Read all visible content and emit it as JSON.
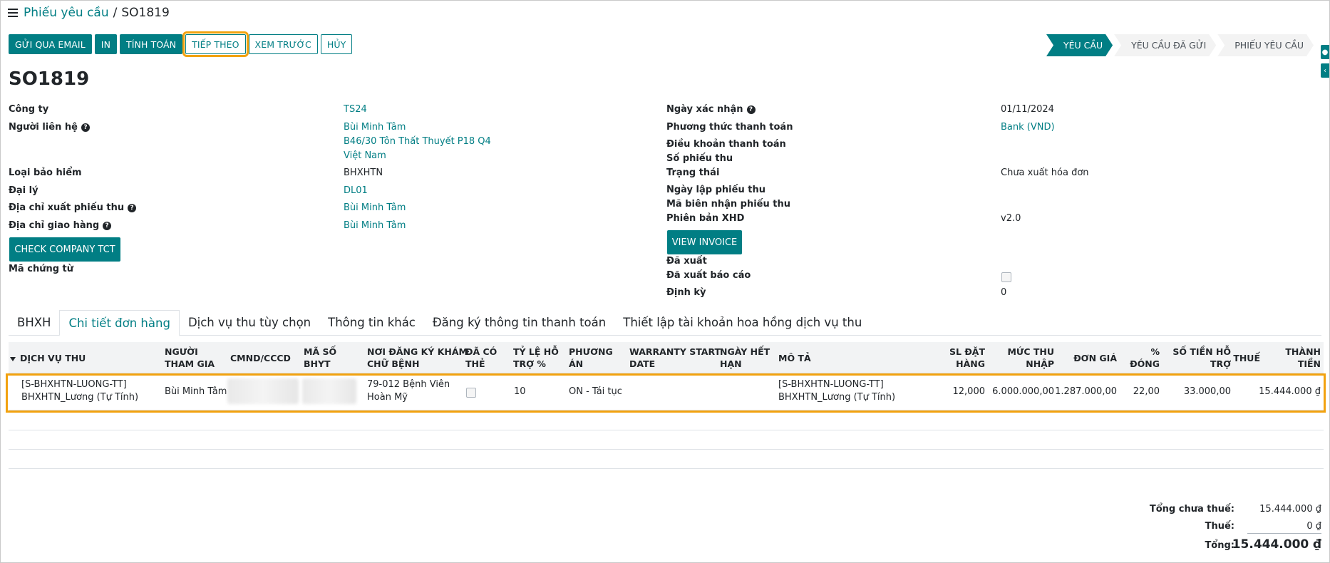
{
  "breadcrumb": {
    "parent": "Phiếu yêu cầu",
    "separator": "/",
    "current": "SO1819"
  },
  "toolbar": {
    "buttons": [
      "GỬI QUA EMAIL",
      "IN",
      "TÍNH TOÁN",
      "TIẾP THEO",
      "XEM TRƯỚC",
      "HỦY"
    ]
  },
  "statusbar": {
    "stages": [
      "YÊU CẦU",
      "YÊU CẦU ĐÃ GỬI",
      "PHIẾU YÊU CẦU"
    ],
    "active": "YÊU CẦU"
  },
  "record": {
    "title": "SO1819"
  },
  "form_left": {
    "company_label": "Công ty",
    "company_value": "TS24",
    "contact_label": "Người liên hệ",
    "contact_name": "Bùi Minh Tâm",
    "contact_addr1": "B46/30 Tôn Thất Thuyết P18 Q4",
    "contact_addr2": "Việt Nam",
    "insurance_label": "Loại bảo hiểm",
    "insurance_value": "BHXHTN",
    "agent_label": "Đại lý",
    "agent_value": "DL01",
    "invoice_addr_label": "Địa chỉ xuất phiếu thu",
    "invoice_addr_value": "Bùi Minh Tâm",
    "delivery_addr_label": "Địa chỉ giao hàng",
    "delivery_addr_value": "Bùi Minh Tâm",
    "check_button": "CHECK COMPANY TCT",
    "doc_code_label": "Mã chứng từ"
  },
  "form_right": {
    "confirm_date_label": "Ngày xác nhận",
    "confirm_date_value": "01/11/2024",
    "payment_method_label": "Phương thức thanh toán",
    "payment_method_value": "Bank (VND)",
    "payment_terms_label": "Điều khoản thanh toán",
    "receipt_no_label": "Số phiếu thu",
    "state_label": "Trạng thái",
    "state_value": "Chưa xuất hóa đơn",
    "receipt_date_label": "Ngày lập phiếu thu",
    "receipt_code_label": "Mã biên nhận phiếu thu",
    "xhd_version_label": "Phiên bản XHD",
    "xhd_version_value": "v2.0",
    "view_invoice_button": "VIEW INVOICE",
    "exported_label": "Đã xuất",
    "report_exported_label": "Đã xuất báo cáo",
    "periodic_label": "Định kỳ",
    "periodic_value": "0"
  },
  "tabs": [
    "BHXH",
    "Chi tiết đơn hàng",
    "Dịch vụ thu tùy chọn",
    "Thông tin khác",
    "Đăng ký thông tin thanh toán",
    "Thiết lập tài khoản hoa hồng dịch vụ thu"
  ],
  "table": {
    "headers": {
      "service": "DỊCH VỤ THU",
      "participant_1": "NGƯỜI",
      "participant_2": "THAM GIA",
      "id_no": "CMND/CCCD",
      "bhyt_1": "MÃ SỐ",
      "bhyt_2": "BHYT",
      "hospital_1": "NƠI ĐĂNG KÝ KHÁM",
      "hospital_2": "CHỮ BỆNH",
      "card_1": "ĐÃ CÓ",
      "card_2": "THẺ",
      "support_rate_1": "TỶ LỆ HỖ",
      "support_rate_2": "TRỢ %",
      "plan_1": "PHƯƠNG",
      "plan_2": "ÁN",
      "warranty_1": "WARRANTY START",
      "warranty_2": "DATE",
      "expiry_1": "NGÀY HẾT",
      "expiry_2": "HẠN",
      "description": "MÔ TẢ",
      "qty_1": "SL ĐẶT",
      "qty_2": "HÀNG",
      "income_1": "MỨC THU",
      "income_2": "NHẬP",
      "unit_price": "ĐƠN GIÁ",
      "pct_1": "%",
      "pct_2": "ĐÓNG",
      "support_amount_1": "SỐ TIỀN HỖ",
      "support_amount_2": "TRỢ",
      "tax": "THUẾ",
      "subtotal_1": "THÀNH",
      "subtotal_2": "TIỀN"
    },
    "rows": [
      {
        "service_1": "[S-BHXHTN-LUONG-TT]",
        "service_2": "BHXHTN_Lương (Tự Tính)",
        "participant": "Bùi Minh Tâm",
        "hospital_1": "79-012 Bệnh Viên",
        "hospital_2": "Hoàn Mỹ",
        "support_rate": "10",
        "plan": "ON - Tái tục",
        "description_1": "[S-BHXHTN-LUONG-TT]",
        "description_2": "BHXHTN_Lương (Tự Tính)",
        "qty": "12,000",
        "income": "6.000.000,00",
        "unit_price": "1.287.000,00",
        "pct": "22,00",
        "support_amount": "33.000,00",
        "subtotal": "15.444.000 ₫"
      }
    ]
  },
  "totals": {
    "untaxed_label": "Tổng chưa thuế:",
    "untaxed_value": "15.444.000 ₫",
    "tax_label": "Thuế:",
    "tax_value": "0 ₫",
    "total_label": "Tổng:",
    "total_value": "15.444.000 ₫"
  },
  "colors": {
    "accent": "#017e84",
    "highlight": "#f2a20f"
  }
}
